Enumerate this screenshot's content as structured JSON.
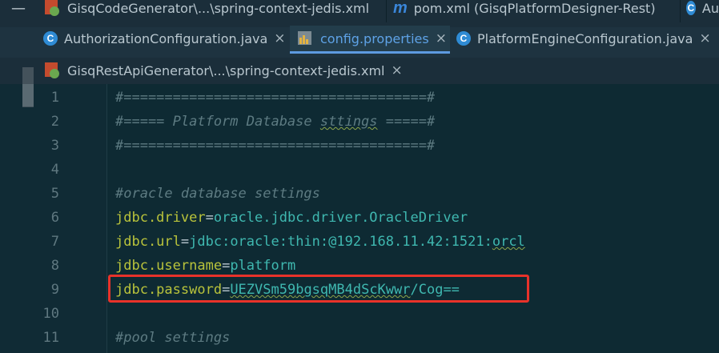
{
  "tabs_row1": [
    {
      "label": "GisqCodeGenerator\\...\\spring-context-jedis.xml",
      "icon": "xml-file-icon"
    },
    {
      "label": "pom.xml (GisqPlatformDesigner-Rest)",
      "icon": "maven-icon"
    },
    {
      "label": "Au",
      "icon": "java-class-icon"
    }
  ],
  "tabs_row2": [
    {
      "label": "AuthorizationConfiguration.java",
      "icon": "java-class-icon",
      "active": false
    },
    {
      "label": "config.properties",
      "icon": "properties-file-icon",
      "active": true
    },
    {
      "label": "PlatformEngineConfiguration.java",
      "icon": "java-class-icon",
      "active": false
    }
  ],
  "tabs_row3": [
    {
      "label": "GisqRestApiGenerator\\...\\spring-context-jedis.xml",
      "icon": "xml-file-icon"
    }
  ],
  "close_glyph": "×",
  "maven_glyph": "m",
  "class_glyph": "C",
  "line_numbers": [
    "1",
    "2",
    "3",
    "4",
    "5",
    "6",
    "7",
    "8",
    "9",
    "10",
    "11"
  ],
  "lines": {
    "l1": "#=====================================#",
    "l2_a": "#===== Platform Database ",
    "l2_b": "sttings",
    "l2_c": " =====#",
    "l3": "#=====================================#",
    "l5": "#oracle database settings",
    "l6_key": "jdbc.driver",
    "l6_val": "oracle.jdbc.driver.OracleDriver",
    "l7_key": "jdbc.url",
    "l7_val_a": "jdbc:oracle:thin:@192.168.11.42:1521:",
    "l7_val_b": "orcl",
    "l8_key": "jdbc.username",
    "l8_val": "platform",
    "l9_key": "jdbc.password",
    "l9_val_a": "UEZVSm59",
    "l9_val_b": "bgsqMB4dScKwwr",
    "l9_val_c": "/Cog==",
    "l11": "#pool settings",
    "eq": "="
  },
  "colors": {
    "highlight": "#e8322a",
    "comment": "#5d7b82",
    "key": "#b9c33b",
    "value": "#3fb8b0"
  }
}
